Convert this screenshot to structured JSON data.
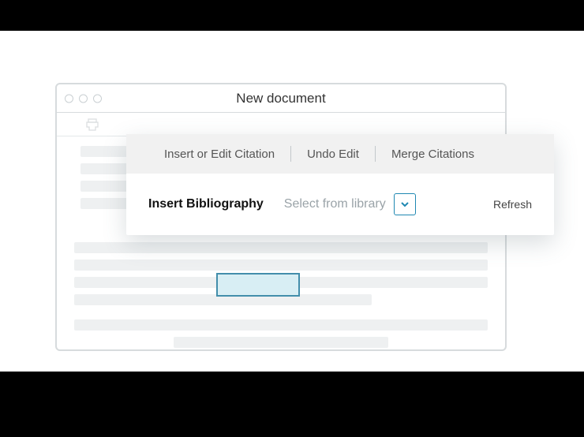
{
  "window": {
    "title": "New document"
  },
  "toolbar": {
    "tabs": {
      "insert_edit": "Insert or Edit Citation",
      "undo": "Undo Edit",
      "merge": "Merge Citations"
    },
    "action_row": {
      "insert_bib": "Insert Bibliography",
      "select_hint": "Select from library",
      "refresh": "Refresh"
    }
  }
}
